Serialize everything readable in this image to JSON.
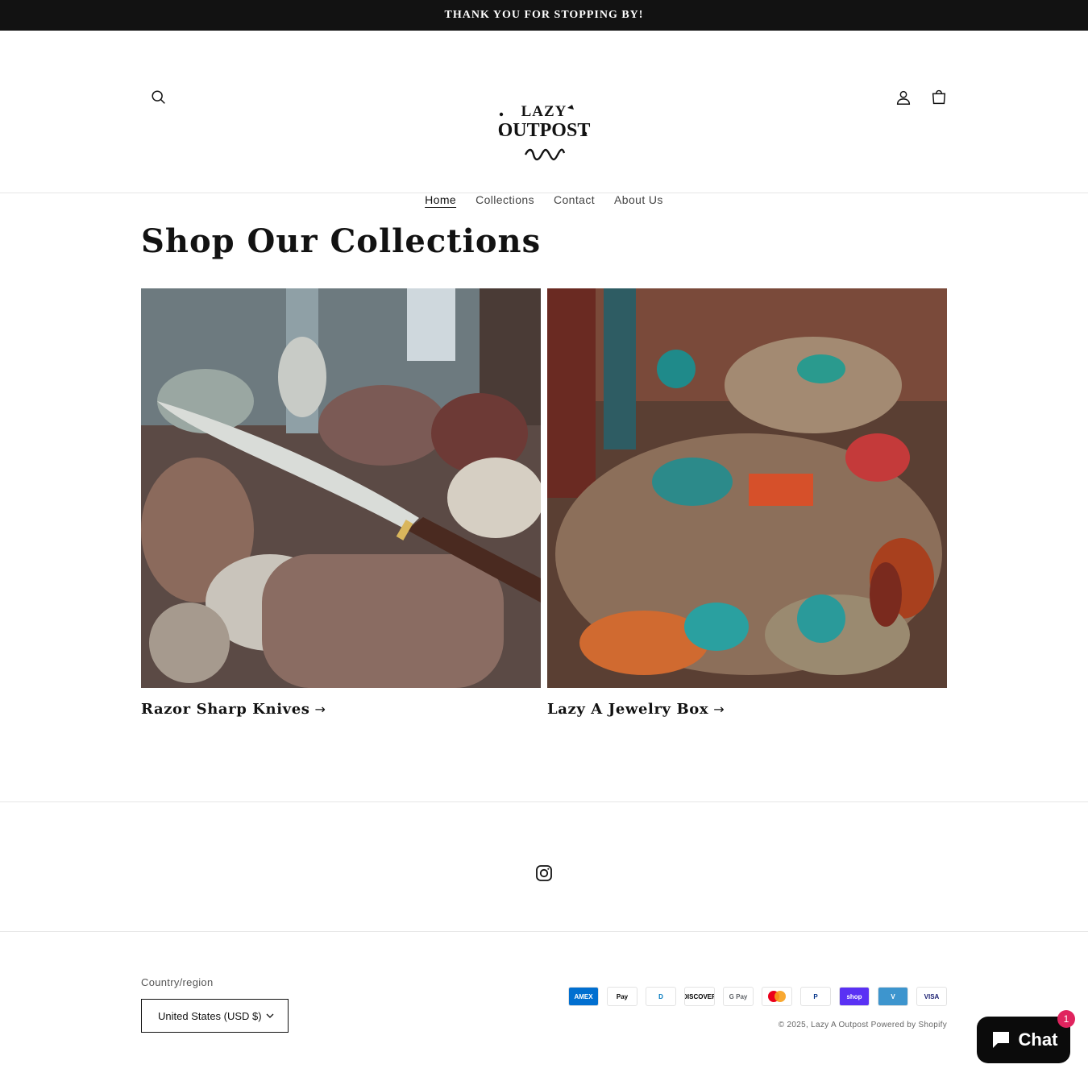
{
  "announcement": {
    "text": "THANK YOU FOR STOPPING BY!"
  },
  "header": {
    "logo": {
      "line1": "LAZY",
      "line2": "OUTPOST"
    },
    "icons": {
      "search": "search-icon",
      "account": "account-icon",
      "cart": "cart-icon"
    }
  },
  "nav": {
    "items": [
      {
        "label": "Home",
        "active": true
      },
      {
        "label": "Collections",
        "active": false
      },
      {
        "label": "Contact",
        "active": false
      },
      {
        "label": "About Us",
        "active": false
      }
    ]
  },
  "main": {
    "title": "Shop Our Collections",
    "collections": [
      {
        "title": "Razor Sharp Knives",
        "arrow": "→"
      },
      {
        "title": "Lazy A Jewelry Box",
        "arrow": "→"
      }
    ]
  },
  "footer": {
    "social": {
      "icon": "instagram-icon"
    },
    "country_label": "Country/region",
    "country_value": "United States (USD $)",
    "payments": [
      {
        "name": "American Express",
        "short": "AMEX",
        "bg": "#016fd0",
        "fg": "#ffffff"
      },
      {
        "name": "Apple Pay",
        "short": "Pay",
        "bg": "#ffffff",
        "fg": "#000000"
      },
      {
        "name": "Diners Club",
        "short": "D",
        "bg": "#ffffff",
        "fg": "#0079be"
      },
      {
        "name": "Discover",
        "short": "DISCOVER",
        "bg": "#ffffff",
        "fg": "#000000"
      },
      {
        "name": "Google Pay",
        "short": "G Pay",
        "bg": "#ffffff",
        "fg": "#5f6368"
      },
      {
        "name": "Mastercard",
        "short": "",
        "bg": "#ffffff",
        "fg": "#000000"
      },
      {
        "name": "PayPal",
        "short": "P",
        "bg": "#ffffff",
        "fg": "#003087"
      },
      {
        "name": "Shop Pay",
        "short": "shop",
        "bg": "#5a31f4",
        "fg": "#ffffff"
      },
      {
        "name": "Venmo",
        "short": "V",
        "bg": "#3d95ce",
        "fg": "#ffffff"
      },
      {
        "name": "Visa",
        "short": "VISA",
        "bg": "#ffffff",
        "fg": "#1a1f71"
      }
    ],
    "copyright": "© 2025, Lazy A Outpost Powered by Shopify"
  },
  "chat": {
    "label": "Chat",
    "badge": "1"
  }
}
